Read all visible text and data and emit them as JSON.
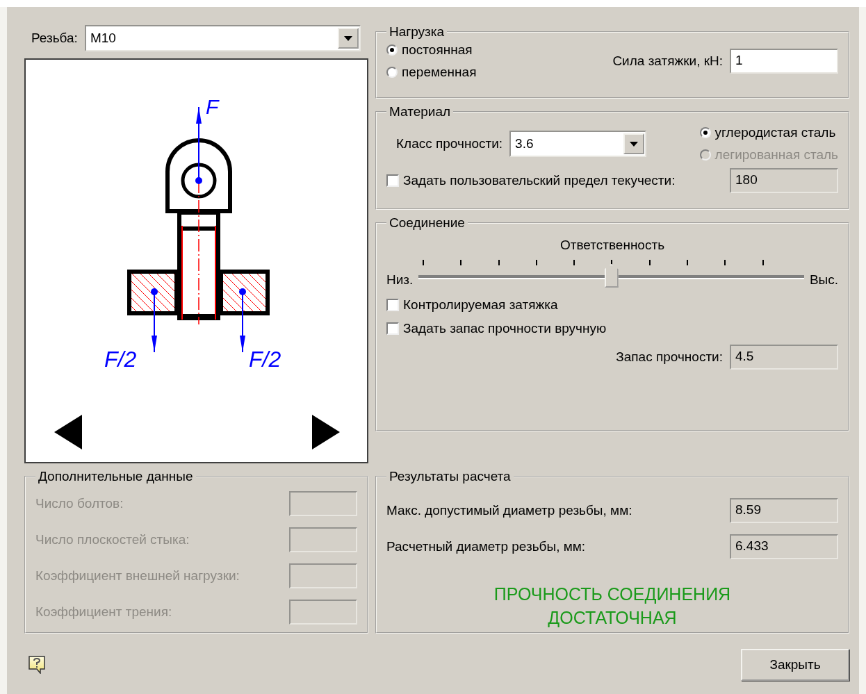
{
  "thread": {
    "label": "Резьба:",
    "value": "M10"
  },
  "diagram": {
    "force_label": "F",
    "left_label": "F/2",
    "right_label": "F/2"
  },
  "load": {
    "title": "Нагрузка",
    "options": [
      {
        "label": "постоянная",
        "selected": true
      },
      {
        "label": "переменная",
        "selected": false
      }
    ],
    "preload": {
      "label": "Сила затяжки, кН:",
      "value": "1"
    }
  },
  "material": {
    "title": "Материал",
    "strength_class": {
      "label": "Класс прочности:",
      "value": "3.6"
    },
    "types": [
      {
        "label": "углеродистая сталь",
        "selected": true,
        "disabled": false
      },
      {
        "label": "легированная сталь",
        "selected": false,
        "disabled": true
      }
    ],
    "custom_yield": {
      "label": "Задать пользовательский предел текучести:",
      "checked": false,
      "value": "180"
    }
  },
  "connection": {
    "title": "Соединение",
    "responsibility": {
      "label": "Ответственность",
      "low": "Низ.",
      "high": "Выс.",
      "level": 0.5
    },
    "options": [
      {
        "label": "Контролируемая затяжка",
        "checked": false
      },
      {
        "label": "Задать запас прочности вручную",
        "checked": false
      }
    ],
    "safety_factor": {
      "label": "Запас прочности:",
      "value": "4.5"
    }
  },
  "extra": {
    "title": "Дополнительные данные",
    "disabled": true,
    "fields": [
      {
        "label": "Число болтов:"
      },
      {
        "label": "Число плоскостей стыка:"
      },
      {
        "label": "Коэффициент внешней нагрузки:"
      },
      {
        "label": "Коэффициент трения:"
      }
    ]
  },
  "results": {
    "title": "Результаты расчета",
    "fields": [
      {
        "label": "Макс. допустимый диаметр резьбы, мм:",
        "value": "8.59"
      },
      {
        "label": "Расчетный диаметр резьбы, мм:",
        "value": "6.433"
      }
    ],
    "verdict": "ПРОЧНОСТЬ СОЕДИНЕНИЯ ДОСТАТОЧНАЯ"
  },
  "close_button": "Закрыть"
}
